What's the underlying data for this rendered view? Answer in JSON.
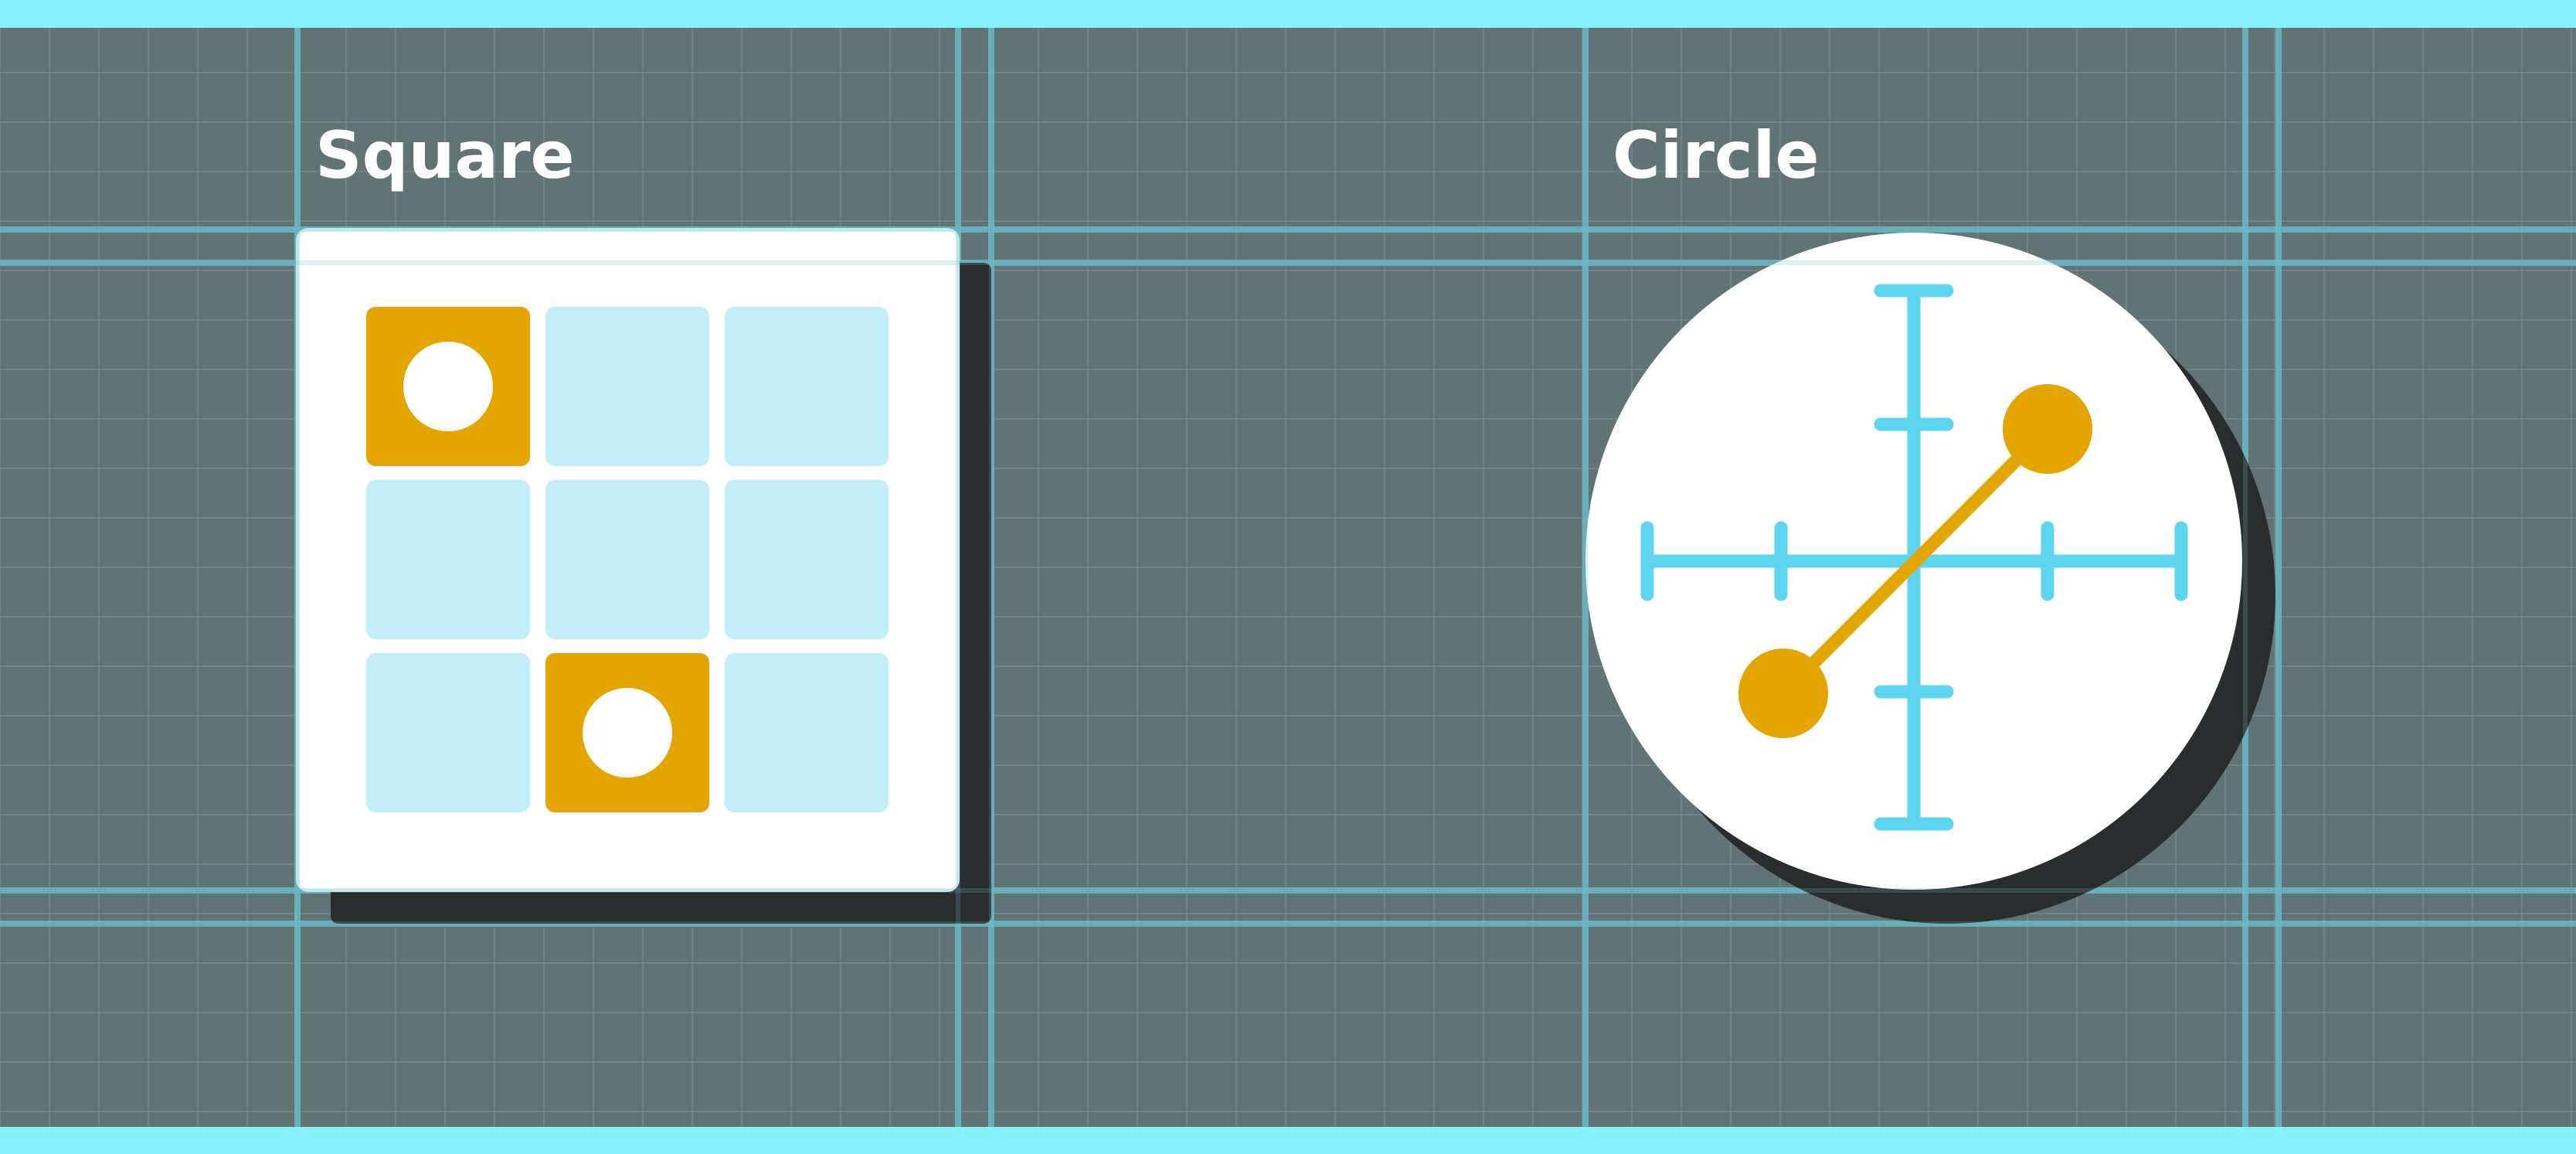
{
  "colors": {
    "background": "#617475",
    "accent_band": "#86F0FB",
    "grid_minor": "#6f8283",
    "guide": "#6BB8C6",
    "card": "#ffffff",
    "shadow": "#2a2d2e",
    "tile_light": "#C2EEFA",
    "tile_active": "#E5A500",
    "axis": "#5ED5EE",
    "marker": "#E5A500"
  },
  "square": {
    "label": "Square",
    "tiles": [
      {
        "state": "active"
      },
      {
        "state": "inactive"
      },
      {
        "state": "inactive"
      },
      {
        "state": "inactive"
      },
      {
        "state": "inactive"
      },
      {
        "state": "inactive"
      },
      {
        "state": "inactive"
      },
      {
        "state": "active"
      },
      {
        "state": "inactive"
      }
    ]
  },
  "circle": {
    "label": "Circle"
  }
}
